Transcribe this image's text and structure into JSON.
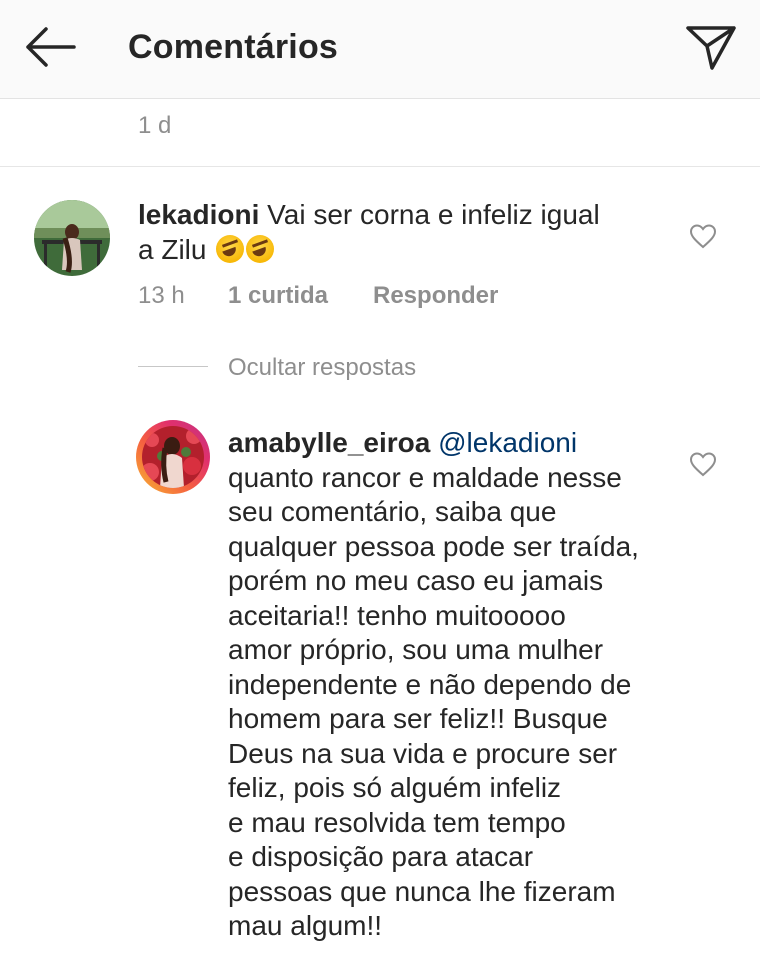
{
  "header": {
    "title": "Comentários",
    "back_icon": "arrow-left-icon",
    "send_icon": "paper-plane-icon"
  },
  "previous_comment": {
    "time": "1 d"
  },
  "comment": {
    "username": "lekadioni",
    "text_lines": [
      "Vai ser corna e infeliz igual",
      "a Zilu"
    ],
    "emojis": [
      "rolling-on-floor-laughing-emoji",
      "rolling-on-floor-laughing-emoji"
    ],
    "time": "13 h",
    "likes": "1 curtida",
    "reply_label": "Responder"
  },
  "hide_replies_label": "Ocultar respostas",
  "reply": {
    "username": "amabylle_eiroa",
    "mention": "@lekadioni",
    "text_lines": [
      "quanto rancor e maldade nesse",
      "seu comentário, saiba que",
      "qualquer pessoa pode ser traída,",
      "porém no meu caso eu jamais",
      "aceitaria!! tenho muitooooo",
      "amor próprio, sou uma mulher",
      "independente e não dependo de",
      "homem para ser feliz!! Busque",
      "Deus na sua vida e procure ser",
      "feliz, pois só alguém infeliz",
      "e mau resolvida tem tempo",
      "e disposição para atacar",
      "pessoas que nunca lhe fizeram",
      "mau algum!!"
    ]
  },
  "colors": {
    "text": "#262626",
    "secondary": "#8e8e8e",
    "mention": "#003569",
    "header_bg": "#fafafa"
  }
}
